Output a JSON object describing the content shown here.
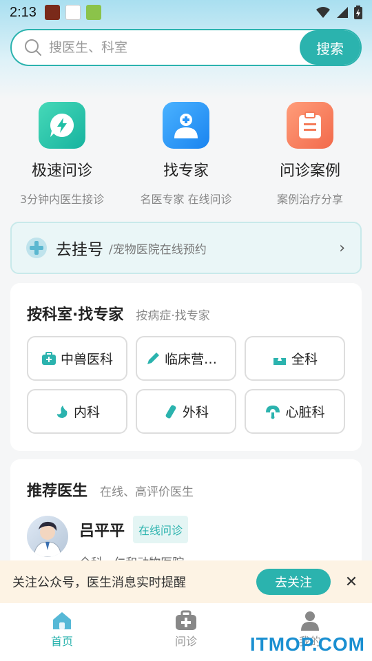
{
  "status_bar": {
    "time": "2:13"
  },
  "search": {
    "placeholder": "搜医生、科室",
    "button_label": "搜索"
  },
  "features": [
    {
      "title": "极速问诊",
      "subtitle": "3分钟内医生接诊",
      "icon": "lightning-chat-icon",
      "color": "#1fbfa5"
    },
    {
      "title": "找专家",
      "subtitle": "名医专家 在线问诊",
      "icon": "doctor-icon",
      "color": "#2a95f8"
    },
    {
      "title": "问诊案例",
      "subtitle": "案例治疗分享",
      "icon": "clipboard-icon",
      "color": "#f47b58"
    }
  ],
  "register": {
    "title": "去挂号",
    "subtitle": "/宠物医院在线预约"
  },
  "department_card": {
    "title": "按科室·找专家",
    "subtitle": "按病症·找专家",
    "departments": [
      {
        "label": "中兽医科",
        "icon": "medkit-icon"
      },
      {
        "label": "临床营养...",
        "icon": "pen-icon"
      },
      {
        "label": "全科",
        "icon": "tooth-icon"
      },
      {
        "label": "内科",
        "icon": "stomach-icon"
      },
      {
        "label": "外科",
        "icon": "bandage-icon"
      },
      {
        "label": "心脏科",
        "icon": "stethoscope-icon"
      }
    ]
  },
  "doctor_card": {
    "title": "推荐医生",
    "subtitle": "在线、高评价医生",
    "doctor": {
      "name": "吕平平",
      "badge": "在线问诊",
      "hospital": "全科 · 仁和动物医院"
    }
  },
  "follow_bar": {
    "text": "关注公众号，医生消息实时提醒",
    "button_label": "去关注"
  },
  "tabs": [
    {
      "label": "首页",
      "icon": "home-icon",
      "active": true
    },
    {
      "label": "问诊",
      "icon": "medkit-icon",
      "active": false
    },
    {
      "label": "我的",
      "icon": "user-icon",
      "active": false
    }
  ],
  "watermark": "ITMOP.COM",
  "colors": {
    "accent": "#2bb3ae"
  }
}
